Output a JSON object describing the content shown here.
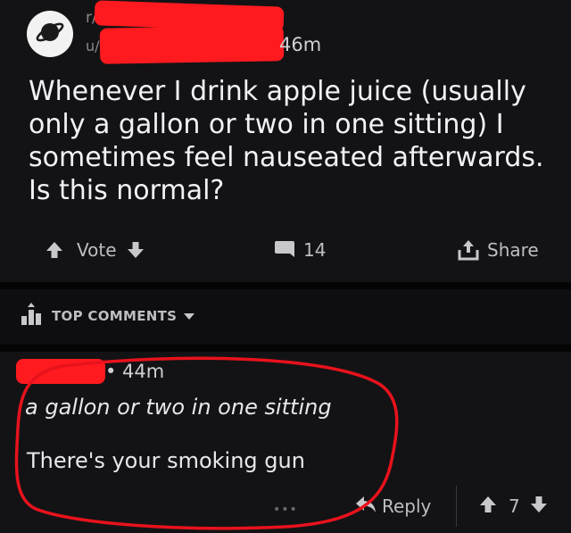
{
  "post": {
    "subreddit_prefix": "r/",
    "user_prefix": "u/",
    "age": "46m",
    "title": "Whenever I drink apple juice (usually only a gallon or two in one sitting) I sometimes feel nauseated afterwards. Is this normal?",
    "actions": {
      "vote_label": "Vote",
      "comment_count": "14",
      "share_label": "Share"
    }
  },
  "section": {
    "top_comments_label": "TOP COMMENTS"
  },
  "comment": {
    "age": "• 44m",
    "quote": "a gallon or two in one sitting",
    "body": "There's your smoking gun",
    "reply_label": "Reply",
    "score": "7",
    "more_label": "•••"
  },
  "colors": {
    "background": "#0e0e10",
    "card": "#131315",
    "redaction": "#ff1a1f",
    "annotation_circle": "#e8121c",
    "text": "#e8e8ea",
    "muted": "#bdbdc2"
  },
  "icons": {
    "subreddit": "planet-icon",
    "upvote": "upvote-icon",
    "downvote": "downvote-icon",
    "comment": "comment-bubble-icon",
    "share": "share-icon",
    "sort": "bar-chart-icon",
    "reply": "reply-arrow-icon"
  }
}
